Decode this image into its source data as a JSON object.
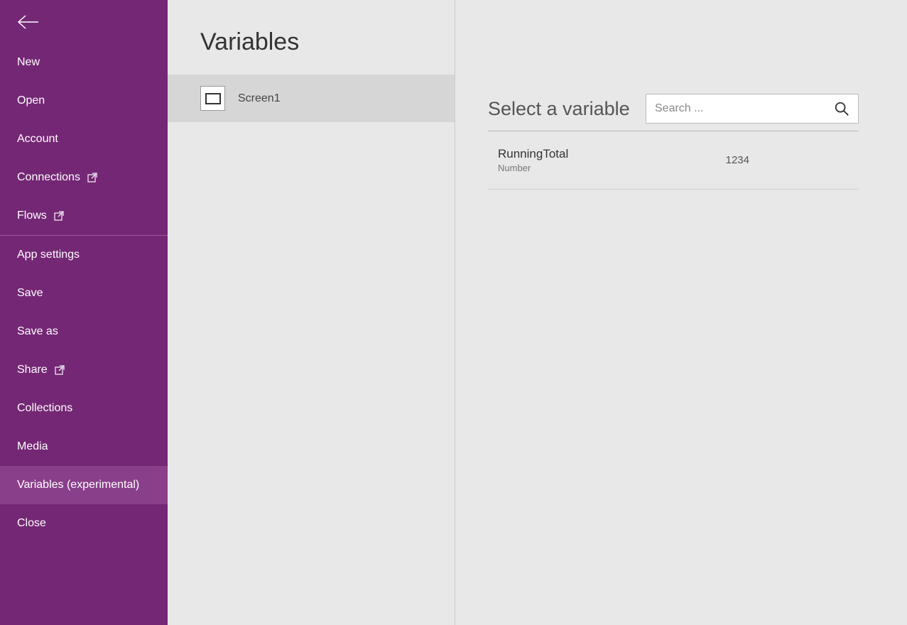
{
  "sidebar": {
    "items": [
      {
        "label": "New",
        "external": false
      },
      {
        "label": "Open",
        "external": false
      },
      {
        "label": "Account",
        "external": false
      },
      {
        "label": "Connections",
        "external": true
      },
      {
        "label": "Flows",
        "external": true
      }
    ],
    "items2": [
      {
        "label": "App settings",
        "external": false
      },
      {
        "label": "Save",
        "external": false
      },
      {
        "label": "Save as",
        "external": false
      },
      {
        "label": "Share",
        "external": true
      },
      {
        "label": "Collections",
        "external": false
      },
      {
        "label": "Media",
        "external": false
      },
      {
        "label": "Variables (experimental)",
        "external": false,
        "selected": true
      },
      {
        "label": "Close",
        "external": false
      }
    ]
  },
  "middle": {
    "title": "Variables",
    "screen_label": "Screen1"
  },
  "right": {
    "select_label": "Select a variable",
    "search_placeholder": "Search ...",
    "variables": [
      {
        "name": "RunningTotal",
        "type": "Number",
        "value": "1234"
      }
    ]
  }
}
